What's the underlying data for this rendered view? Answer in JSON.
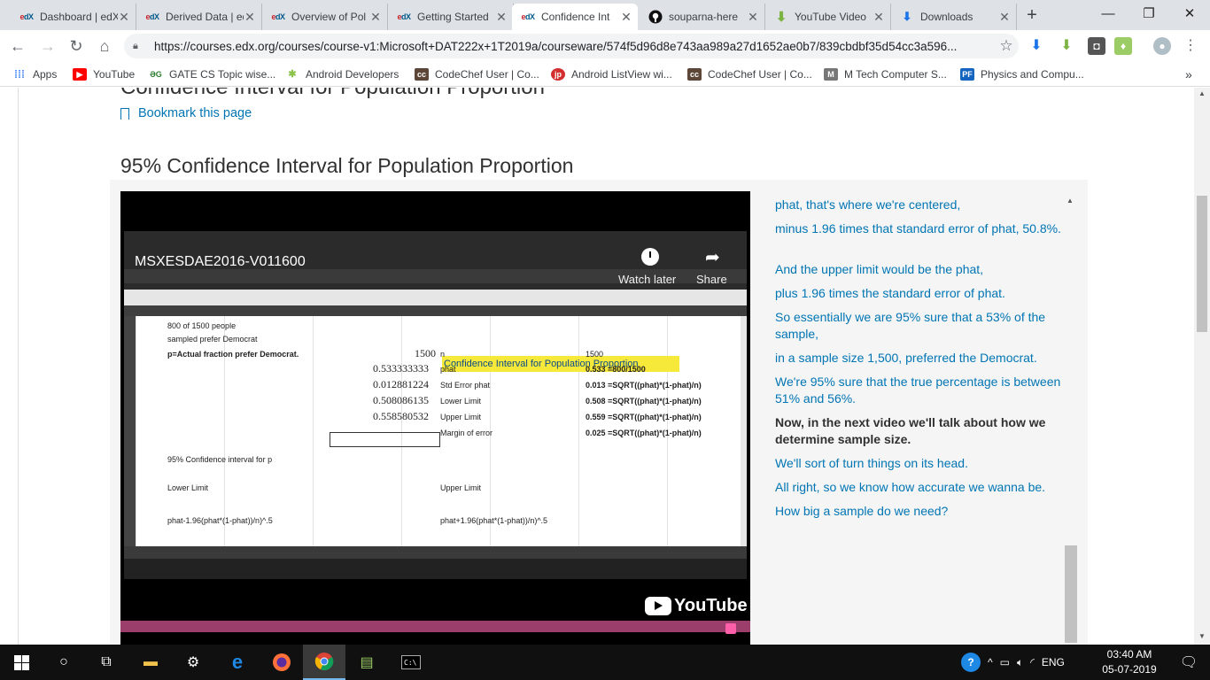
{
  "browser": {
    "tabs": [
      {
        "label": "Dashboard | edX",
        "icon": "edx",
        "active": false
      },
      {
        "label": "Derived Data | edX",
        "icon": "edx",
        "active": false
      },
      {
        "label": "Overview of Pol",
        "icon": "edx",
        "active": false
      },
      {
        "label": "Getting Started",
        "icon": "edx",
        "active": false
      },
      {
        "label": "Confidence Int",
        "icon": "edx",
        "active": true
      },
      {
        "label": "souparna-here",
        "icon": "github",
        "active": false
      },
      {
        "label": "YouTube Video",
        "icon": "download-arrow",
        "active": false
      },
      {
        "label": "Downloads",
        "icon": "download",
        "active": false
      }
    ],
    "new_tab_glyph": "+",
    "window_controls": {
      "minimize": "—",
      "restore": "❐",
      "close": "✕"
    },
    "url": "https://courses.edx.org/courses/course-v1:Microsoft+DAT222x+1T2019a/courseware/574f5d96d8e743aa989a27d1652ae0b7/839cbdbf35d54cc3a596...",
    "bookmarks": [
      {
        "label": "Apps",
        "icon": "apps-grid"
      },
      {
        "label": "YouTube",
        "icon": "youtube"
      },
      {
        "label": "GATE CS Topic wise...",
        "icon": "gate"
      },
      {
        "label": "Android Developers",
        "icon": "android"
      },
      {
        "label": "CodeChef User | Co...",
        "icon": "codechef"
      },
      {
        "label": "Android ListView wi...",
        "icon": "jp"
      },
      {
        "label": "CodeChef User | Co...",
        "icon": "codechef"
      },
      {
        "label": "M Tech Computer S...",
        "icon": "mtech"
      },
      {
        "label": "Physics and Compu...",
        "icon": "pf"
      }
    ],
    "bookmarks_overflow": "»"
  },
  "page": {
    "heading_cut": "Confidence Interval for Population Proportion",
    "bookmark_link": "Bookmark this page",
    "unit_title": "95% Confidence Interval for Population Proportion"
  },
  "video": {
    "title": "MSXESDAE2016-V011600",
    "watch_later": "Watch later",
    "share": "Share",
    "youtube_logo": "YouTube",
    "spreadsheet": {
      "title_cell": "Confidence Interval for Population Proportion",
      "a_col": [
        "800 of 1500 people",
        "sampled prefer Democrat",
        "p=Actual fraction prefer Democrat.",
        "95% Confidence interval for p",
        "Lower Limit",
        "phat-1.96(phat*(1-phat))/n)^.5"
      ],
      "c_col": [
        "1500",
        "0.533333333",
        "0.012881224",
        "0.508086135",
        "0.558580532"
      ],
      "d_col": [
        "n",
        "phat",
        "Std Error phat",
        "Lower Limit",
        "Upper Limit",
        "Margin of error",
        "Upper Limit",
        "phat+1.96(phat*(1-phat))/n)^.5"
      ],
      "e_col": [
        "1500",
        "0.533 =800/1500",
        "0.013 =SQRT((phat)*(1-phat)/n)",
        "0.508 =SQRT((phat)*(1-phat)/n)",
        "0.559 =SQRT((phat)*(1-phat)/n)",
        "0.025 =SQRT((phat)*(1-phat)/n)"
      ]
    }
  },
  "transcript": [
    {
      "text": "phat, that's where we're centered,",
      "current": false
    },
    {
      "text": "minus 1.96 times that standard error of phat, 50.8%.",
      "current": false
    },
    {
      "text": "And the upper limit would be the phat,",
      "current": false
    },
    {
      "text": "plus 1.96 times the standard error of phat.",
      "current": false
    },
    {
      "text": "So essentially we are 95% sure that a 53% of the sample,",
      "current": false
    },
    {
      "text": "in a sample size 1,500, preferred the Democrat.",
      "current": false
    },
    {
      "text": "We're 95% sure that the true percentage is between 51% and 56%.",
      "current": false
    },
    {
      "text": "Now, in the next video we'll talk about how we determine sample size.",
      "current": true
    },
    {
      "text": "We'll sort of turn things on its head.",
      "current": false
    },
    {
      "text": "All right, so we know how accurate we wanna be.",
      "current": false
    },
    {
      "text": "How big a sample do we need?",
      "current": false
    }
  ],
  "taskbar": {
    "language": "ENG",
    "time": "03:40 AM",
    "date": "05-07-2019"
  },
  "colors": {
    "edx_link": "#0075b4",
    "tab_strip": "#dee1e6",
    "progress_bar": "#9c3e6b",
    "highlight": "#f7e93a"
  }
}
